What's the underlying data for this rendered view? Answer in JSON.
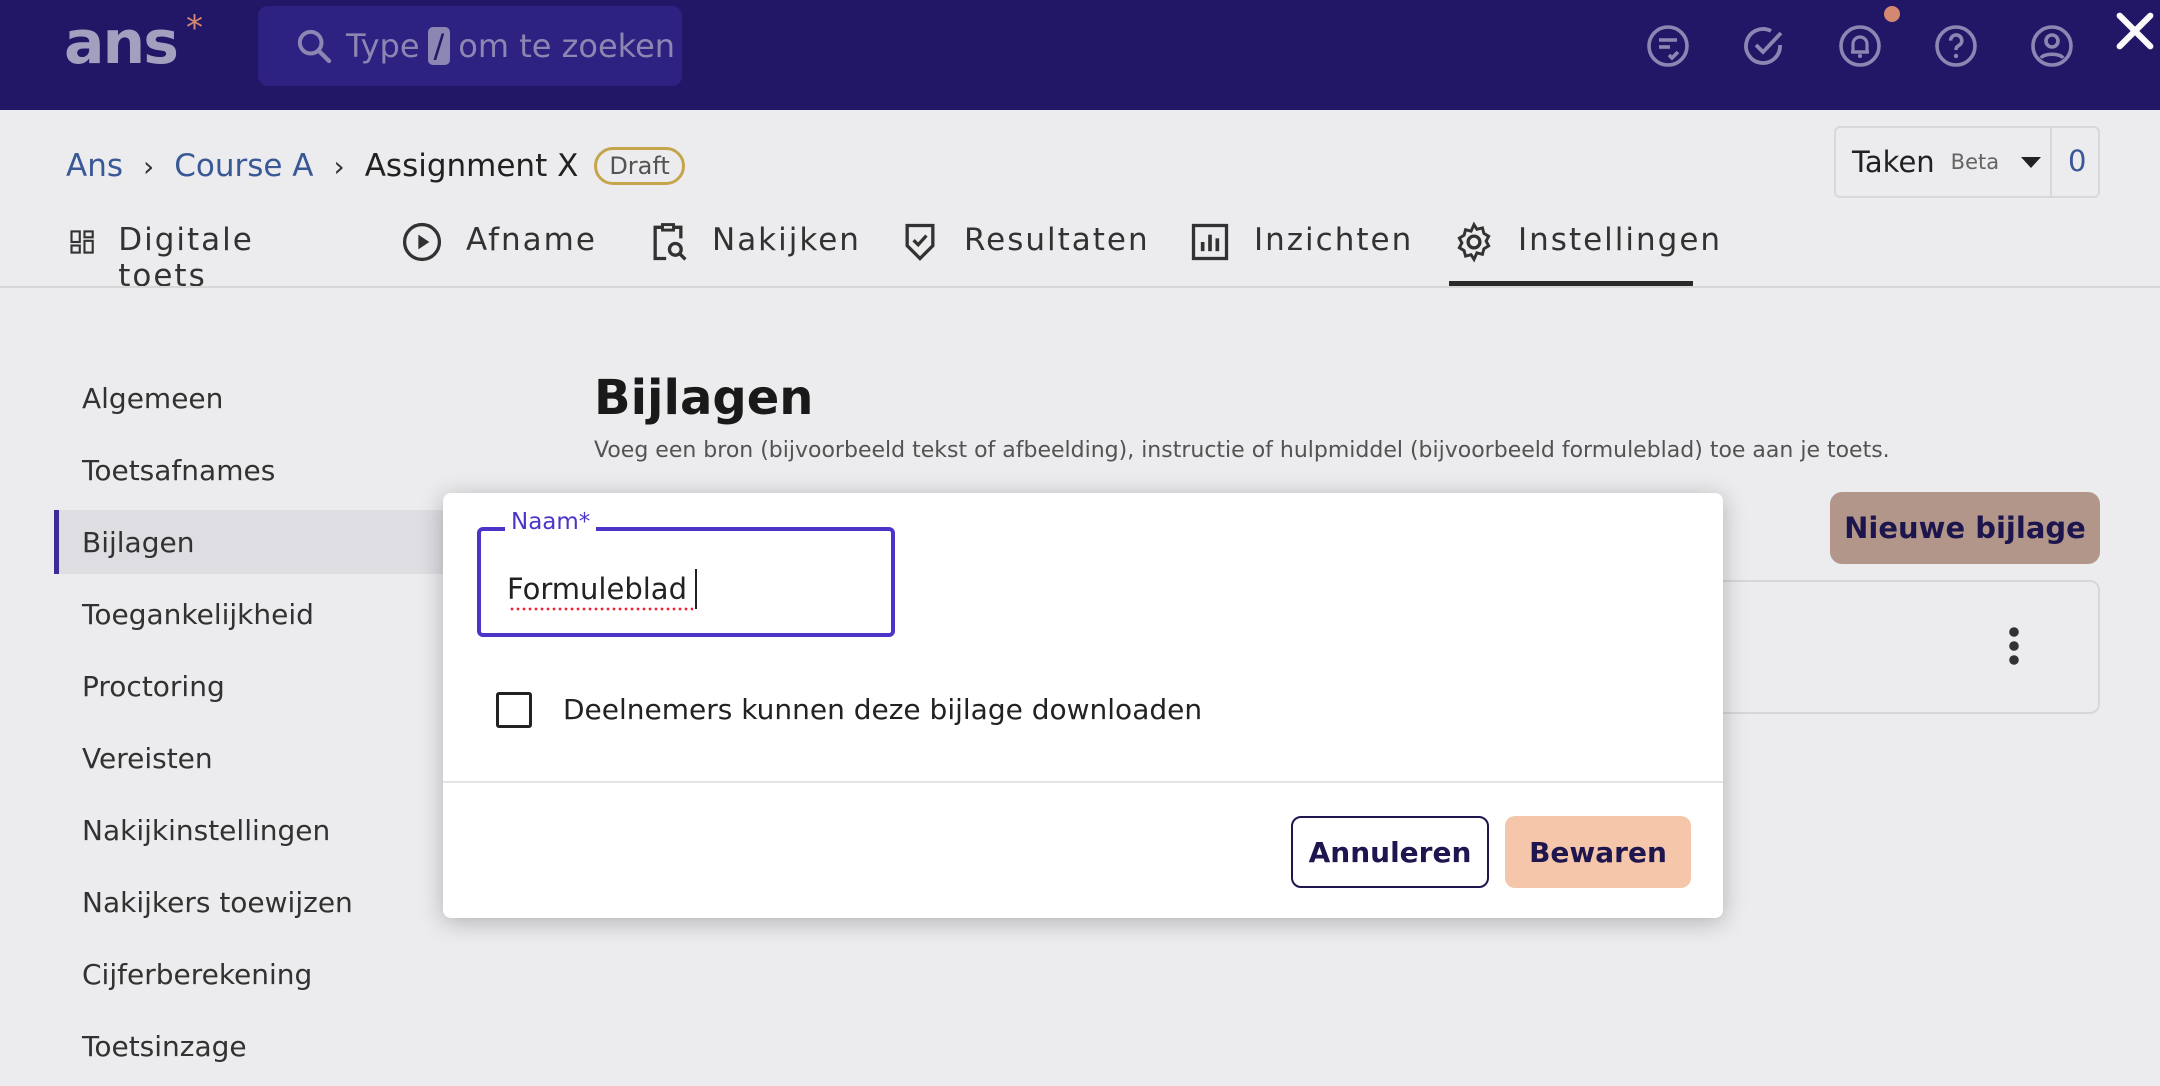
{
  "app": {
    "logo": "ans",
    "logo_mark": "*"
  },
  "search": {
    "prefix": "Type",
    "key": "/",
    "suffix": "om te zoeken"
  },
  "breadcrumb": {
    "items": [
      "Ans",
      "Course A"
    ],
    "current": "Assignment X",
    "badge": "Draft"
  },
  "taken": {
    "label": "Taken",
    "beta": "Beta",
    "count": "0"
  },
  "tabs": [
    {
      "label": "Digitale toets",
      "icon": "dashboard-icon"
    },
    {
      "label": "Afname",
      "icon": "play-icon"
    },
    {
      "label": "Nakijken",
      "icon": "clipboard-search-icon"
    },
    {
      "label": "Resultaten",
      "icon": "shield-check-icon"
    },
    {
      "label": "Inzichten",
      "icon": "bar-chart-icon"
    },
    {
      "label": "Instellingen",
      "icon": "gear-icon",
      "active": true
    }
  ],
  "sidenav": {
    "items": [
      "Algemeen",
      "Toetsafnames",
      "Bijlagen",
      "Toegankelijkheid",
      "Proctoring",
      "Vereisten",
      "Nakijkinstellingen",
      "Nakijkers toewijzen",
      "Cijferberekening",
      "Toetsinzage"
    ],
    "active": "Bijlagen"
  },
  "main": {
    "title": "Bijlagen",
    "description": "Voeg een bron (bijvoorbeeld tekst of afbeelding), instructie of hulpmiddel (bijvoorbeeld formuleblad) toe aan je toets.",
    "new_button": "Nieuwe bijlage"
  },
  "modal": {
    "name_label": "Naam*",
    "name_value": "Formuleblad",
    "download_label": "Deelnemers kunnen deze bijlage downloaden",
    "download_checked": false,
    "cancel_label": "Annuleren",
    "save_label": "Bewaren"
  },
  "colors": {
    "topbar": "#23186a",
    "accent": "#4a35c8",
    "save": "#f6c6ab",
    "badge_border": "#c9a94e"
  }
}
